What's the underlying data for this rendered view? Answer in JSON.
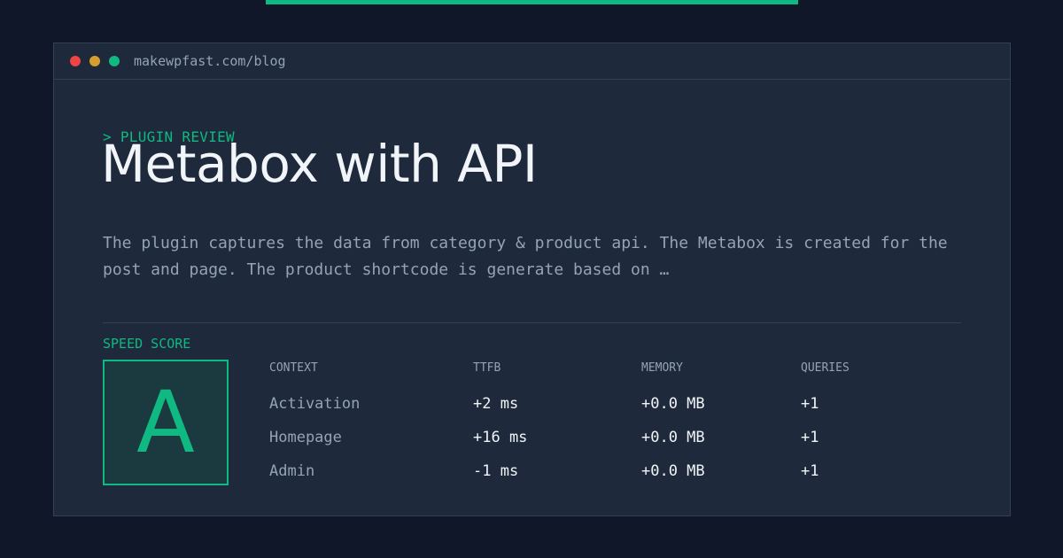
{
  "window": {
    "url": "makewpfast.com/blog"
  },
  "eyebrow": "> PLUGIN REVIEW",
  "title": "Metabox with API",
  "description": "The plugin captures the data from category & product api. The Metabox is created for the post and page. The product shortcode is generate based on …",
  "score": {
    "label": "SPEED SCORE",
    "grade": "A"
  },
  "table": {
    "headers": [
      "CONTEXT",
      "TTFB",
      "MEMORY",
      "QUERIES"
    ],
    "rows": [
      {
        "context": "Activation",
        "ttfb": "+2 ms",
        "memory": "+0.0 MB",
        "queries": "+1"
      },
      {
        "context": "Homepage",
        "ttfb": "+16 ms",
        "memory": "+0.0 MB",
        "queries": "+1"
      },
      {
        "context": "Admin",
        "ttfb": "-1 ms",
        "memory": "+0.0 MB",
        "queries": "+1"
      }
    ]
  },
  "colors": {
    "accent": "#10b981",
    "background": "#0f1729",
    "panel": "#1e293b"
  },
  "icons": [
    "close-dot-icon",
    "minimize-dot-icon",
    "maximize-dot-icon"
  ]
}
